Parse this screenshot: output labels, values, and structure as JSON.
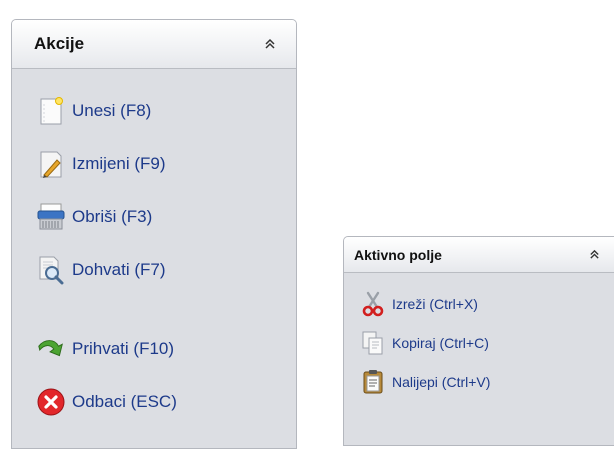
{
  "actions_panel": {
    "title": "Akcije",
    "collapse_icon": "double-chevron-up-icon",
    "items": [
      {
        "label": "Unesi (F8)",
        "icon": "new-document-icon"
      },
      {
        "label": "Izmijeni (F9)",
        "icon": "edit-document-icon"
      },
      {
        "label": "Obriši (F3)",
        "icon": "shredder-icon"
      },
      {
        "label": "Dohvati (F7)",
        "icon": "search-document-icon"
      },
      {
        "label": "Prihvati (F10)",
        "icon": "green-arrow-icon"
      },
      {
        "label": "Odbaci (ESC)",
        "icon": "red-x-icon"
      }
    ]
  },
  "field_panel": {
    "title": "Aktivno polje",
    "collapse_icon": "double-chevron-up-icon",
    "items": [
      {
        "label": "Izreži (Ctrl+X)",
        "icon": "scissors-icon"
      },
      {
        "label": "Kopiraj (Ctrl+C)",
        "icon": "copy-icon"
      },
      {
        "label": "Nalijepi (Ctrl+V)",
        "icon": "clipboard-icon"
      }
    ]
  },
  "colors": {
    "panel_bg": "#dcdee3",
    "link_text": "#1d3a8a",
    "border": "#b4b7be"
  }
}
